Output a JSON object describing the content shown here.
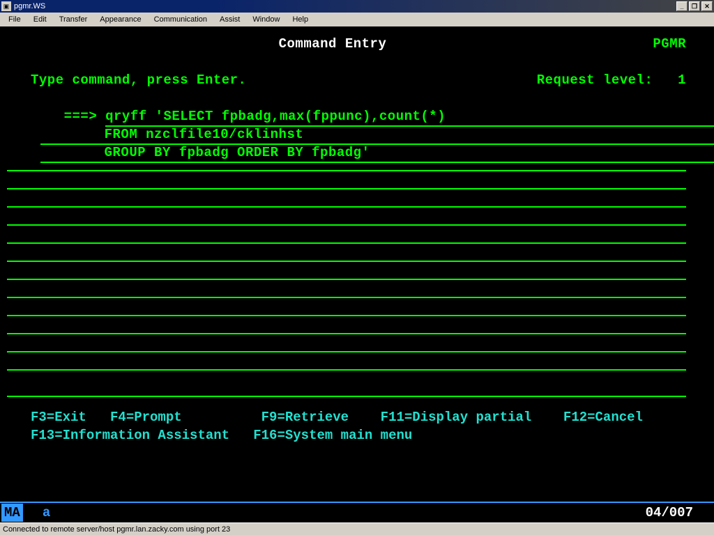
{
  "window": {
    "title": "pgmr.WS"
  },
  "menubar": [
    "File",
    "Edit",
    "Transfer",
    "Appearance",
    "Communication",
    "Assist",
    "Window",
    "Help"
  ],
  "screen": {
    "title": "Command Entry",
    "user": "PGMR",
    "request_level_label": "Request level:",
    "request_level_value": "1",
    "instruction": "Type command, press Enter.",
    "prompt": "===>",
    "command_lines": [
      "qryff 'SELECT fpbadg,max(fppunc),count(*)",
      "FROM nzclfile10/cklinhst",
      "GROUP BY fpbadg ORDER BY fpbadg'"
    ],
    "fkeys_row1": "F3=Exit   F4=Prompt          F9=Retrieve    F11=Display partial    F12=Cancel",
    "fkeys_row2": "F13=Information Assistant   F16=System main menu"
  },
  "oia": {
    "indicator": "MA",
    "mode": "a",
    "cursor": "04/007"
  },
  "statusbar": "Connected to remote server/host pgmr.lan.zacky.com using port 23"
}
